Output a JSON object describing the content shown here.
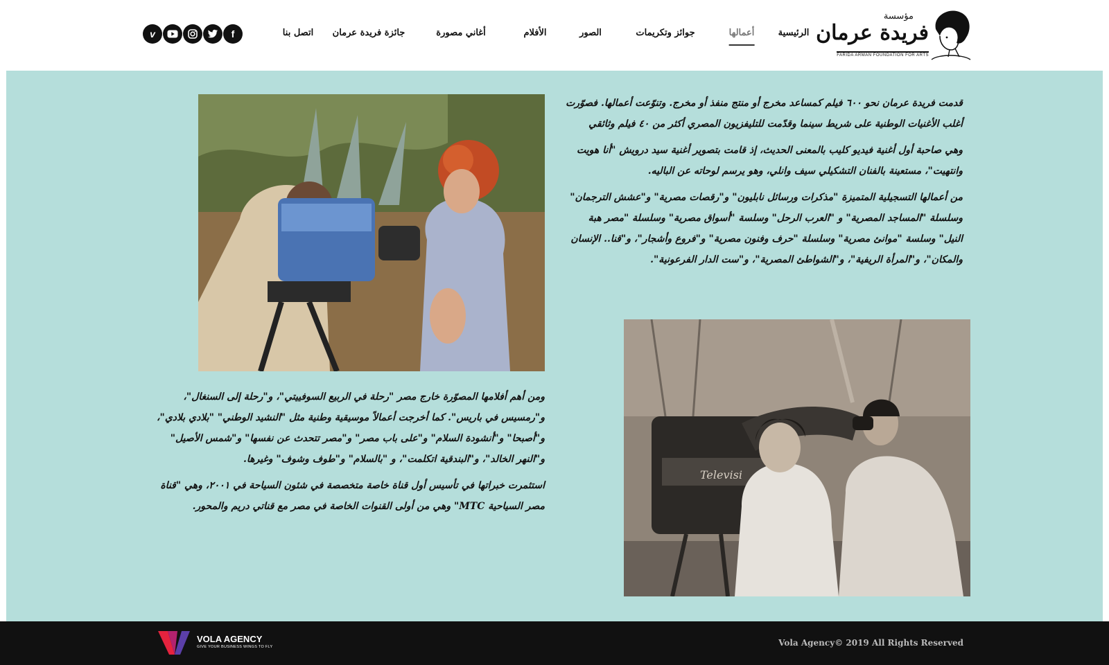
{
  "header": {
    "logo": {
      "prefix": "مؤسسة",
      "name": "فريدة عرمان",
      "english": "FARIDA ARMAN FOUNDATION FOR ARTS"
    },
    "nav": [
      {
        "label": "الرئيسية",
        "active": false
      },
      {
        "label": "أعمالها",
        "active": true
      },
      {
        "label": "جوائز وتكريمات",
        "active": false
      },
      {
        "label": "الصور",
        "active": false
      },
      {
        "label": "الأفلام",
        "active": false
      },
      {
        "label": "أغاني مصورة",
        "active": false
      },
      {
        "label": "جائزة فريدة عرمان",
        "active": false
      },
      {
        "label": "اتصل بنا",
        "active": false
      }
    ],
    "social": [
      {
        "icon": "facebook-icon",
        "glyph": "f"
      },
      {
        "icon": "twitter-icon",
        "glyph": ""
      },
      {
        "icon": "instagram-icon",
        "glyph": ""
      },
      {
        "icon": "youtube-icon",
        "glyph": ""
      },
      {
        "icon": "vimeo-icon",
        "glyph": "v"
      }
    ]
  },
  "content": {
    "block_right": [
      "قدمت فريدة عرمان نحو ٦٠٠ فيلم كمساعد مخرج أو منتج منفذ أو مخرج. وتنوّعت أعمالها. فصوّرت أغلب الأغنيات الوطنية على شريط سينما وقدّمت للتليفزيون المصري أكثر من ٤٠ فيلم وثائقي",
      "وهي صاحبة أول أغنية فيديو كليب بالمعنى الحديث، إذ قامت بتصوير أغنية سيد درويش \"أنا هويت وانتهيت\"، مستعينة بالفنان التشكيلي سيف وانلي، وهو يرسم لوحاته عن الباليه.",
      "من أعمالها التسجيلية المتميزة \"مذكرات ورسائل نابليون\" و\"رقصات مصرية\" و\"عشش الترجمان\" وسلسلة \"المساجد المصرية\" و \"العرب الرحل\" وسلسة \"أسواق مصرية\" وسلسلة \"مصر هبة النيل\" وسلسة \"موانئ مصرية\" وسلسلة \"حرف وفنون مصرية\" و\"فروع وأشجار\"، و\"قنا.. الإنسان والمكان\"، و\"المرأة الريفية\"، و\"الشواطئ المصرية\"، و\"ست الدار الفرعونية\"."
    ],
    "block_left": [
      "ومن أهم أفلامها المصوّرة خارج مصر \"رحلة في الربيع السوفييتي\"، و\"رحلة إلى السنغال\"، و\"رمسيس في باريس\". كما أخرجت أعمالاً موسيقية وطنية مثل \"النشيد الوطني\" \"بلادي بلادي\"، و\"أصبحا\" و\"أنشودة السلام\" و\"على باب مصر\" و\"مصر تتحدث عن نفسها\" و\"شمس الأصيل\" و\"النهر الخالد\"، و\"البندقية اتكلمت\"، و \"بالسلام\" و\"طوف وشوف\" وغيرها.",
      "استثمرت خبراتها في تأسيس أول قناة خاصة متخصصة في شئون السياحة في ٢٠٠١، وهي \"قناة مصر السياحية MTC\" وهي من أولى القنوات الخاصة في مصر مع قناتي دريم والمحور."
    ]
  },
  "footer": {
    "agency_name": "VOLA AGENCY",
    "agency_tagline": "GIVE YOUR BUSINESS WINGS TO FLY",
    "copyright": "Vola Agency© 2019 All Rights Reserved"
  },
  "colors": {
    "content_bg": "#b5dedb",
    "footer_bg": "#111111",
    "text": "#111111"
  }
}
